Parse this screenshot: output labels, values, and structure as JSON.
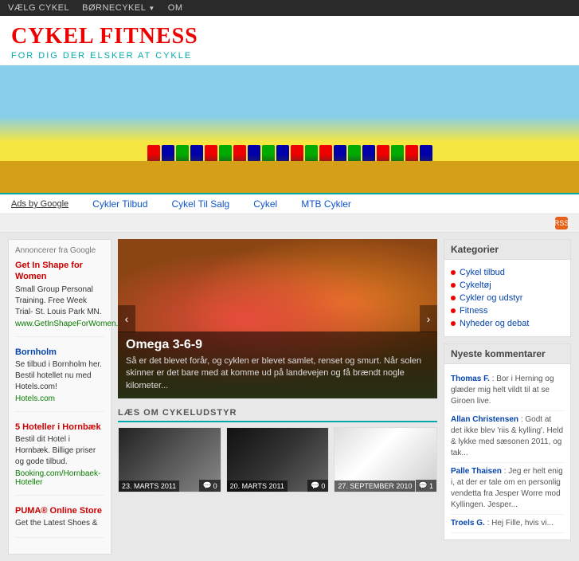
{
  "nav": {
    "items": [
      {
        "label": "VÆLG CYKEL",
        "dropdown": false
      },
      {
        "label": "BØRNECYKEL",
        "dropdown": true
      },
      {
        "label": "OM",
        "dropdown": false
      }
    ]
  },
  "header": {
    "title": "CYKEL FITNESS",
    "subtitle": "FOR DIG DER ELSKER AT CYKLE"
  },
  "adbar": {
    "ads_label": "Ads by Google",
    "links": [
      {
        "label": "Cykler Tilbud"
      },
      {
        "label": "Cykel Til Salg"
      },
      {
        "label": "Cykel"
      },
      {
        "label": "MTB Cykler"
      }
    ]
  },
  "left_sidebar": {
    "announce_header": "Annoncerer fra Google",
    "ads": [
      {
        "title": "Get In Shape for Women",
        "body": "Small Group Personal Training. Free Week Trial- St. Louis Park MN.",
        "url": "www.GetInShapeForWomen.c...",
        "color": "red"
      },
      {
        "title": "Bornholm",
        "body": "Se tilbud i Bornholm her. Bestil hotellet nu med Hotels.com!",
        "url": "Hotels.com",
        "color": "blue"
      },
      {
        "title": "5 Hoteller i Hornbæk",
        "body": "Bestil dit Hotel i Hornbæk. Billige priser og gode tilbud.",
        "url": "Booking.com/Hornbaek-Hoteller",
        "color": "red"
      },
      {
        "title": "PUMA® Online Store",
        "body": "Get the Latest Shoes &",
        "url": "",
        "color": "red"
      }
    ]
  },
  "featured": {
    "title": "Omega 3-6-9",
    "excerpt": "Så er det blevet forår, og cyklen er blevet samlet, renset og smurt. Når solen skinner er det bare med at komme ud på landevejen og få brændt nogle kilometer...",
    "prev_label": "‹",
    "next_label": "›"
  },
  "section": {
    "heading": "LÆS OM CYKELUDSTYR"
  },
  "thumbnails": [
    {
      "date": "23. MARTS 2011",
      "comments": "0",
      "bg": "dark1"
    },
    {
      "date": "20. MARTS 2011",
      "comments": "0",
      "bg": "dark2"
    },
    {
      "date": "27. SEPTEMBER 2010",
      "comments": "1",
      "bg": "light"
    }
  ],
  "right_sidebar": {
    "categories_heading": "Kategorier",
    "categories": [
      {
        "label": "Cykel tilbud"
      },
      {
        "label": "Cykeltøj"
      },
      {
        "label": "Cykler og udstyr"
      },
      {
        "label": "Fitness"
      },
      {
        "label": "Nyheder og debat"
      }
    ],
    "comments_heading": "Nyeste kommentarer",
    "comments": [
      {
        "author": "Thomas F.",
        "text": "Bor i Herning og glæder mig helt vildt til at se Giroen live."
      },
      {
        "author": "Allan Christensen",
        "text": "Godt at det ikke blev 'riis & kylling'. Held & lykke med sæsonen 2011, og tak..."
      },
      {
        "author": "Palle Thaisen",
        "text": "Jeg er helt enig i, at der er tale om en personlig vendetta fra Jesper Worre mod Kyllingen. Jesper..."
      },
      {
        "author": "Troels G.",
        "text": "Hej Fille, hvis vi..."
      }
    ]
  }
}
